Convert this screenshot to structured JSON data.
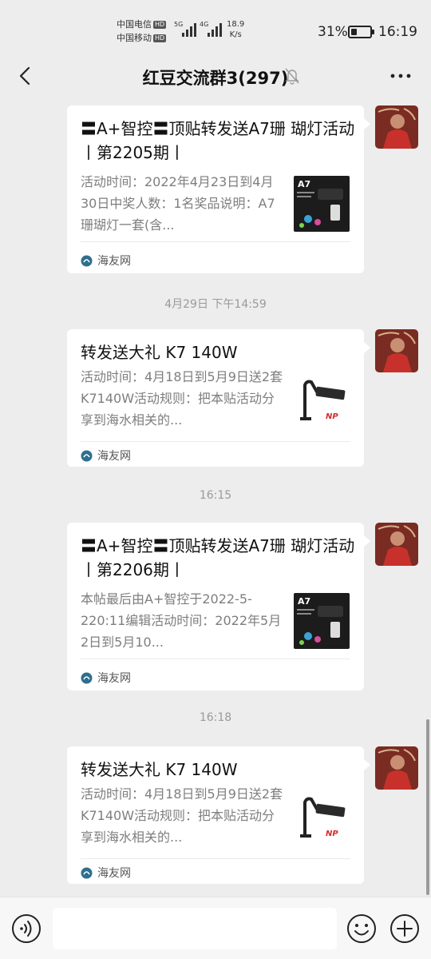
{
  "status_bar": {
    "carrier_1": "中国电信",
    "carrier_2": "中国移动",
    "hd": "HD",
    "net_1": "5G",
    "net_2": "4G",
    "speed_value": "18.9",
    "speed_unit": "K/s",
    "battery_percent": "31%",
    "battery_level": 0.31,
    "time": "16:19"
  },
  "header": {
    "title": "红豆交流群3(297)"
  },
  "messages": [
    {
      "title": "〓A+智控〓顶贴转发送A7珊 瑚灯活动丨第2205期丨",
      "desc": "活动时间：2022年4月23日到4月30日中奖人数：1名奖品说明：A7珊瑚灯一套(含...",
      "source": "海友网",
      "thumb": "a7-lamp"
    },
    {
      "timestamp": "4月29日 下午14:59",
      "title": "转发送大礼 K7 140W",
      "desc": "活动时间：4月18日到5月9日送2套K7140W活动规则：把本贴活动分享到海水相关的...",
      "source": "海友网",
      "thumb": "k7-lamp"
    },
    {
      "timestamp": "16:15",
      "title": "〓A+智控〓顶贴转发送A7珊 瑚灯活动丨第2206期丨",
      "desc": "本帖最后由A+智控于2022-5-220:11编辑活动时间：2022年5月2日到5月10...",
      "source": "海友网",
      "thumb": "a7-lamp"
    },
    {
      "timestamp": "16:18",
      "title": "转发送大礼 K7 140W",
      "desc": "活动时间：4月18日到5月9日送2套K7140W活动规则：把本贴活动分享到海水相关的...",
      "source": "海友网",
      "thumb": "k7-lamp"
    }
  ],
  "thumb_text": {
    "a7": "A7",
    "np": "NP"
  },
  "input": {
    "placeholder": ""
  },
  "icons": {
    "back": "back-arrow-icon",
    "mute": "bell-muted-icon",
    "more": "more-dots-icon",
    "voice": "voice-icon",
    "emoji": "emoji-icon",
    "plus": "plus-icon",
    "source": "haiyou-logo-icon"
  },
  "colors": {
    "background": "#ededed",
    "card": "#ffffff",
    "muted_text": "#7e7e7e",
    "timestamp": "#9a9a9a"
  }
}
